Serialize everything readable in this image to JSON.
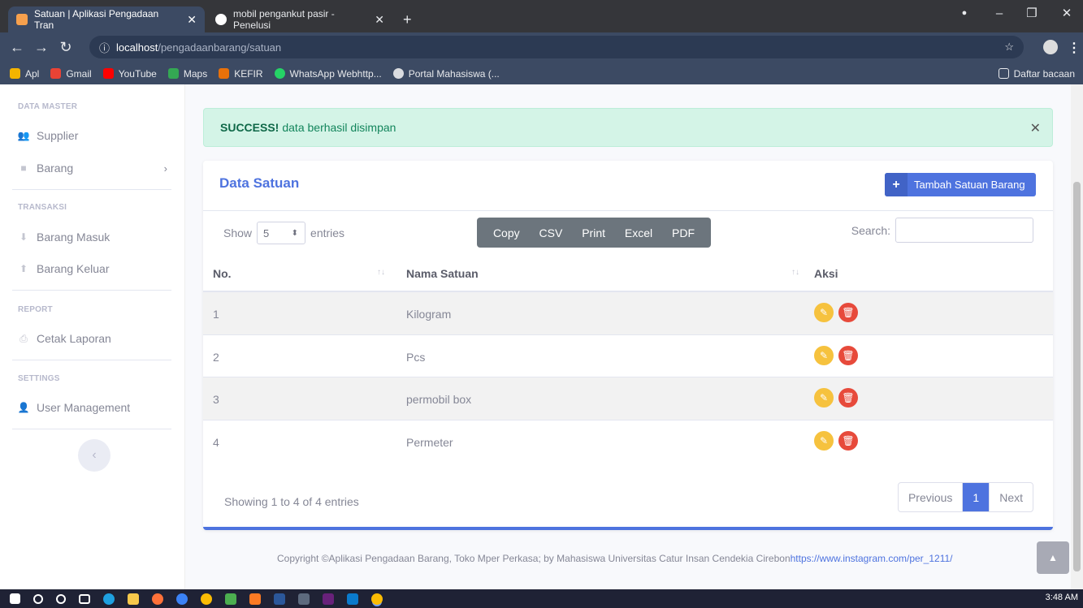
{
  "browser": {
    "tabs": [
      {
        "title": "Satuan | Aplikasi Pengadaan Tran",
        "active": true
      },
      {
        "title": "mobil pengankut pasir - Penelusi",
        "active": false
      }
    ],
    "url_host": "localhost",
    "url_path": "/pengadaanbarang/satuan",
    "bookmarks": [
      "Apl",
      "Gmail",
      "YouTube",
      "Maps",
      "KEFIR",
      "WhatsApp Webhttp...",
      "Portal Mahasiswa (..."
    ],
    "reading_list": "Daftar bacaan"
  },
  "sidebar": {
    "sections": [
      {
        "title": "DATA MASTER",
        "items": [
          "Supplier",
          "Barang"
        ]
      },
      {
        "title": "TRANSAKSI",
        "items": [
          "Barang Masuk",
          "Barang Keluar"
        ]
      },
      {
        "title": "REPORT",
        "items": [
          "Cetak Laporan"
        ]
      },
      {
        "title": "SETTINGS",
        "items": [
          "User Management"
        ]
      }
    ]
  },
  "alert": {
    "strong": "SUCCESS!",
    "text": "data berhasil disimpan"
  },
  "card": {
    "title": "Data Satuan",
    "add_label": "Tambah Satuan Barang",
    "show_label": "Show",
    "entries_value": "5",
    "entries_label": "entries",
    "export_buttons": [
      "Copy",
      "CSV",
      "Print",
      "Excel",
      "PDF"
    ],
    "search_label": "Search:",
    "columns": [
      "No.",
      "Nama Satuan",
      "Aksi"
    ],
    "rows": [
      {
        "no": "1",
        "name": "Kilogram"
      },
      {
        "no": "2",
        "name": "Pcs"
      },
      {
        "no": "3",
        "name": "permobil box"
      },
      {
        "no": "4",
        "name": "Permeter"
      }
    ],
    "info": "Showing 1 to 4 of 4 entries",
    "pager": {
      "prev": "Previous",
      "page": "1",
      "next": "Next"
    }
  },
  "footer": {
    "text": "Copyright ©Aplikasi Pengadaan Barang, Toko Mper Perkasa; by Mahasiswa Universitas Catur Insan Cendekia Cirebon",
    "link": "https://www.instagram.com/per_1211/"
  },
  "clock": "3:48 AM"
}
